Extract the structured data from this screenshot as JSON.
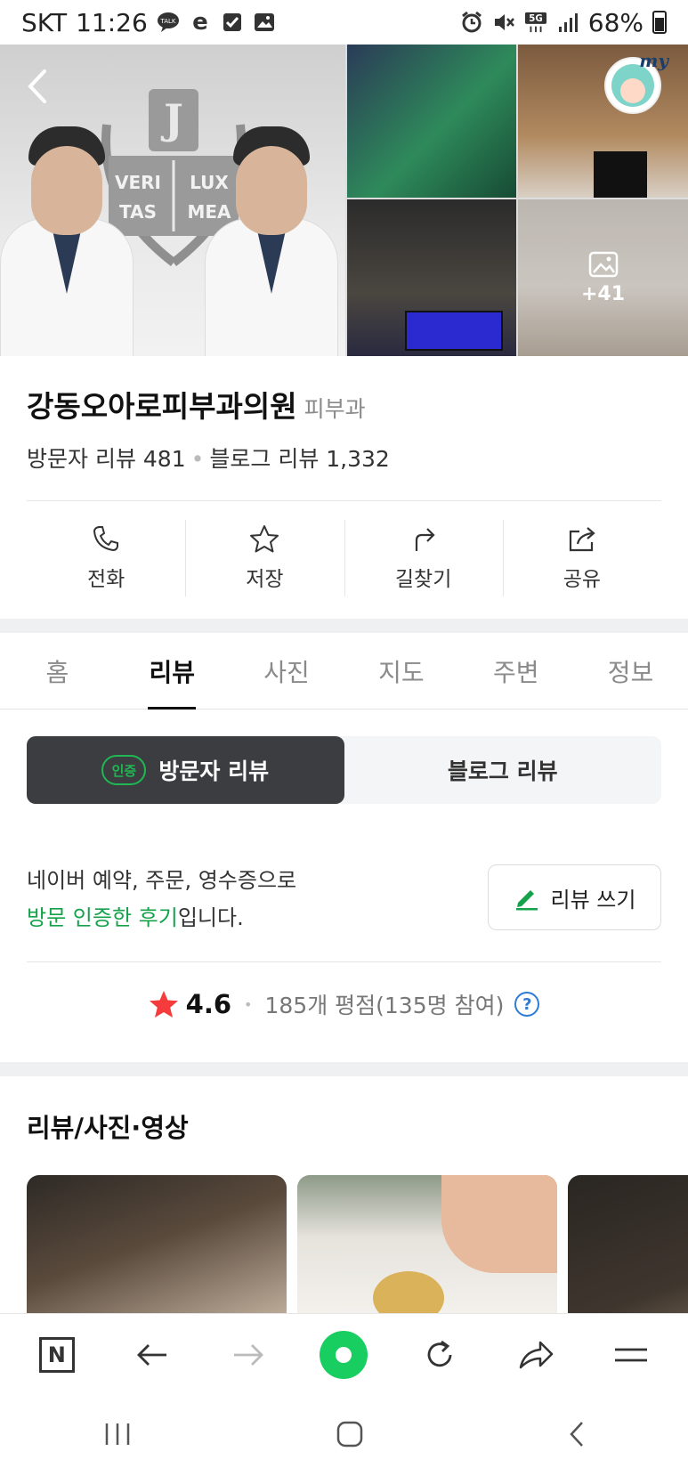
{
  "status_bar": {
    "carrier": "SKT",
    "time": "11:26",
    "left_icons": [
      "talk-icon",
      "e-icon",
      "checkbox-icon",
      "gallery-icon"
    ],
    "right_icons": [
      "alarm-icon",
      "mute-icon",
      "5g-icon",
      "signal-icon"
    ],
    "battery": "68%"
  },
  "hero": {
    "emblem_text": [
      "VERI",
      "LUX",
      "TAS",
      "MEA"
    ],
    "more_photos": "+41",
    "profile_badge": "my"
  },
  "place": {
    "name": "강동오아로피부과의원",
    "category": "피부과",
    "visitor_reviews": "방문자 리뷰 481",
    "blog_reviews": "블로그 리뷰 1,332"
  },
  "actions": [
    {
      "label": "전화",
      "icon": "phone-icon"
    },
    {
      "label": "저장",
      "icon": "star-icon"
    },
    {
      "label": "길찾기",
      "icon": "directions-icon"
    },
    {
      "label": "공유",
      "icon": "share-icon"
    }
  ],
  "tabs": [
    "홈",
    "리뷰",
    "사진",
    "지도",
    "주변",
    "정보"
  ],
  "active_tab": "리뷰",
  "segment": {
    "badge": "인증",
    "visitor": "방문자 리뷰",
    "blog": "블로그 리뷰"
  },
  "notice": {
    "line1": "네이버 예약, 주문, 영수증으로",
    "highlight": "방문 인증한 후기",
    "suffix": "입니다."
  },
  "write_review": "리뷰 쓰기",
  "rating": {
    "score": "4.6",
    "info": "185개 평점(135명 참여)",
    "help": "?"
  },
  "section_title": "리뷰/사진·영상",
  "colors": {
    "brand_green": "#19ce60",
    "text_green": "#14a24a",
    "segment_active": "#3c3d40",
    "star_red": "#f53b3b",
    "help_blue": "#2d7bd6"
  },
  "browser_bar": [
    "naver-n-icon",
    "back-arrow-icon",
    "forward-arrow-icon",
    "green-dot-home-icon",
    "refresh-icon",
    "share-arrow-icon",
    "menu-icon"
  ],
  "system_nav": [
    "recents-icon",
    "home-icon",
    "back-icon"
  ]
}
